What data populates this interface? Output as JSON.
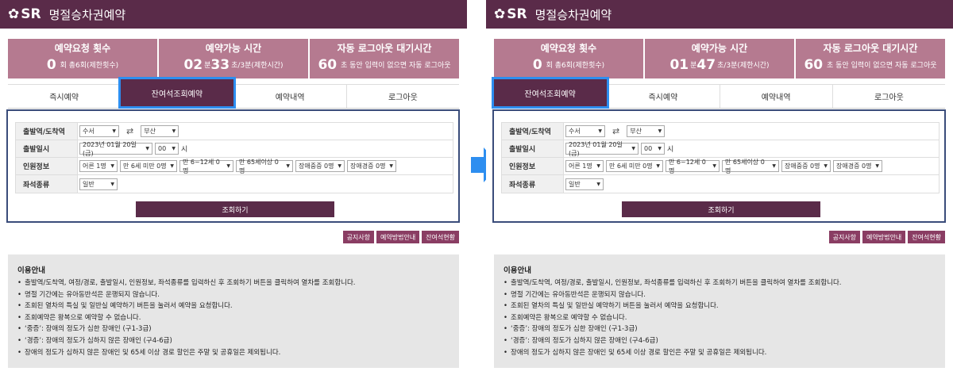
{
  "app": {
    "brand": "SR",
    "title": "명절승차권예약"
  },
  "stats_labels": {
    "req_title": "예약요청 횟수",
    "req_unit": "회",
    "req_note": "총6회(제한횟수)",
    "time_title": "예약가능 시간",
    "time_min_unit": "분",
    "time_sec_unit": "초/3분(제한시간)",
    "logout_title": "자동 로그아웃 대기시간",
    "logout_unit": "초 동안 입력이 없으면 자동 로그아웃"
  },
  "left": {
    "stats": {
      "req_count": "0",
      "min": "02",
      "sec": "33",
      "logout_sec": "60"
    },
    "tabs": [
      "즉시예약",
      "잔여석조회예약",
      "예약내역",
      "로그아웃"
    ]
  },
  "right": {
    "stats": {
      "req_count": "0",
      "min": "01",
      "sec": "47",
      "logout_sec": "60"
    },
    "tabs": [
      "잔여석조회예약",
      "즉시예약",
      "예약내역",
      "로그아웃"
    ]
  },
  "form": {
    "labels": {
      "station": "출발역/도착역",
      "datetime": "출발일시",
      "passengers": "인원정보",
      "seat": "좌석종류"
    },
    "from": "수서",
    "to": "부산",
    "date": "2023년 01월 20일(금)",
    "hour": "00",
    "hour_unit": "시",
    "pax": [
      "어른 1명",
      "만 6세 미만 0명",
      "만 6~12세 0명",
      "만 65세이상 0명",
      "장애중증 0명",
      "장애경증 0명"
    ],
    "seat_type": "일반",
    "search_label": "조회하기"
  },
  "links": [
    "공지사항",
    "예약방법안내",
    "잔여석현황"
  ],
  "guide": {
    "title": "이용안내",
    "items": [
      "출발역/도착역, 여정/경로, 출발일시, 인원정보, 좌석종류를 입력하신 후 조회하기 버튼을 클릭하여 열차를 조회합니다.",
      "명절 기간에는 유아동반석은 운행되지 않습니다.",
      "조회된 열차의 특실 및 일반실 예약하기 버튼을 눌러서 예약을 요청합니다.",
      "조회예약은 왕복으로 예약할 수 없습니다.",
      "‘중증’: 장애의 정도가 심한 장애인 (구1-3급)",
      "‘경증’: 장애의 정도가 심하지 않은 장애인 (구4-6급)",
      "장애의 정도가 심하지 않은 장애인 및 65세 이상 경로 할인은 주말 및 공휴일은 제외됩니다."
    ]
  },
  "colors": {
    "header": "#5a2b49",
    "stat_bg": "#b57a90",
    "highlight": "#2d8ef0",
    "arrow": "#2d8ef0"
  }
}
